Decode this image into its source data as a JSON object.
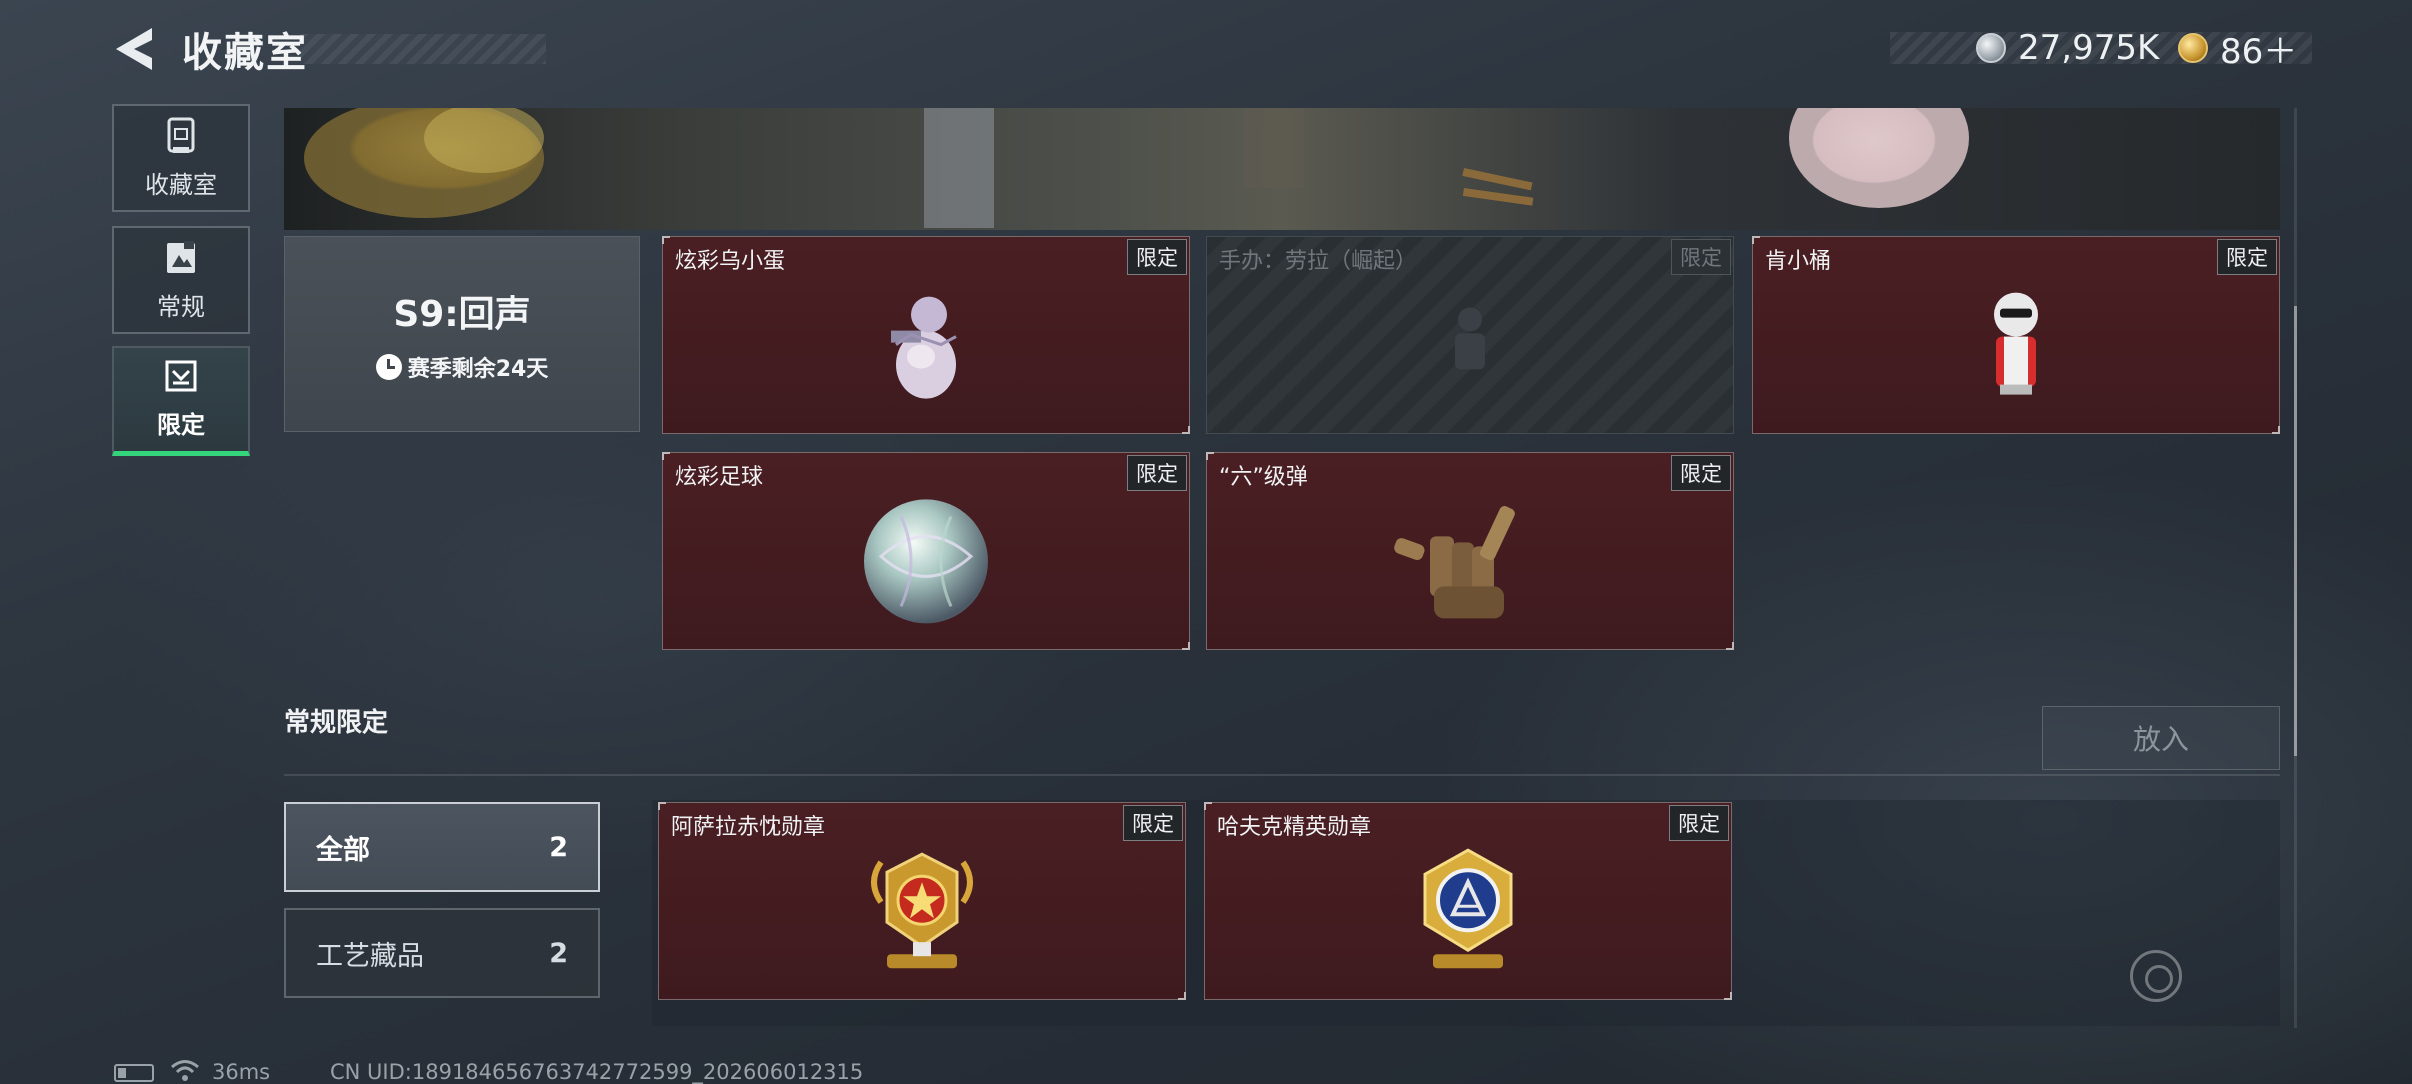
{
  "header": {
    "title": "收藏室",
    "currency_silver": "27,975K",
    "currency_gold": "86＋"
  },
  "sidebar": {
    "items": [
      {
        "label": "收藏室",
        "icon": "display-case-icon"
      },
      {
        "label": "常规",
        "icon": "image-card-icon"
      },
      {
        "label": "限定",
        "icon": "limited-icon"
      }
    ]
  },
  "season": {
    "title": "S9:回声",
    "remaining": "赛季剩余24天"
  },
  "limited_items": [
    {
      "name": "炫彩乌小蛋",
      "tag": "限定",
      "locked": false
    },
    {
      "name": "手办：劳拉（崛起）",
      "tag": "限定",
      "locked": true
    },
    {
      "name": "肯小桶",
      "tag": "限定",
      "locked": false
    },
    {
      "name": "炫彩足球",
      "tag": "限定",
      "locked": false
    },
    {
      "name": "“六”级弹",
      "tag": "限定",
      "locked": false
    }
  ],
  "regular": {
    "section_title": "常规限定",
    "put_button": "放入",
    "filters": [
      {
        "label": "全部",
        "count": "2"
      },
      {
        "label": "工艺藏品",
        "count": "2"
      }
    ],
    "items": [
      {
        "name": "阿萨拉赤忱勋章",
        "tag": "限定"
      },
      {
        "name": "哈夫克精英勋章",
        "tag": "限定"
      }
    ]
  },
  "footer": {
    "ping": "36ms",
    "uid": "CN UID:1891846567637427725​99_202606012315"
  },
  "colors": {
    "accent_green": "#33d47a",
    "card_red": "#4a1f23",
    "background": "#2d353f"
  }
}
